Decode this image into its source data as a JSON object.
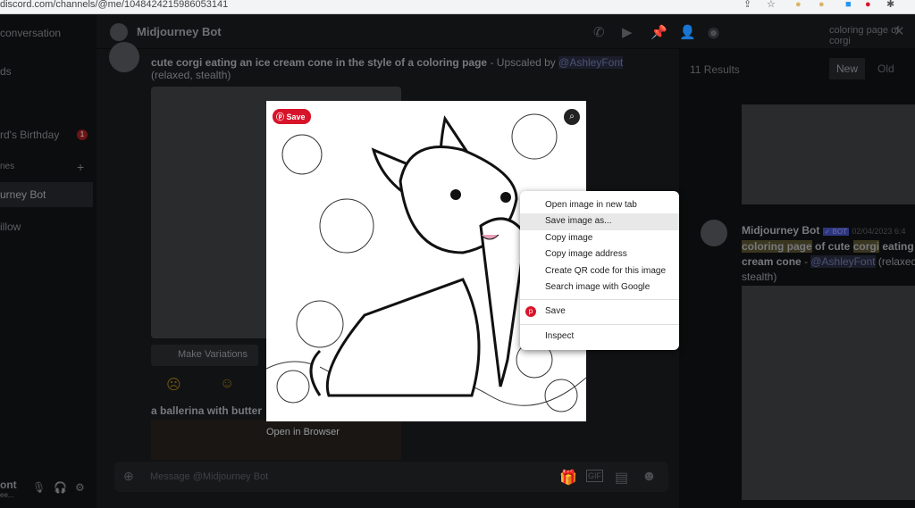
{
  "browser": {
    "url": "discord.com/channels/@me/1048424215986053141"
  },
  "sidebar": {
    "items": [
      {
        "label": "conversation"
      },
      {
        "label": "ds"
      },
      {
        "label": "rd's Birthday",
        "badge": "1"
      },
      {
        "label": "nes",
        "action": "+"
      },
      {
        "label": "urney Bot"
      },
      {
        "label": "illow"
      }
    ],
    "user": {
      "name": "ont",
      "status": "ee..."
    }
  },
  "header": {
    "title": "Midjourney Bot",
    "search": "coloring page of corgi"
  },
  "messages": [
    {
      "text": "cute corgi eating an ice cream cone in the style of a coloring page",
      "suffix": " - Upscaled by ",
      "mention": "@AshleyFont",
      "meta": "(relaxed, stealth)"
    },
    {
      "button": "Make Variations"
    },
    {
      "text": "a ballerina with butter"
    }
  ],
  "results": {
    "count": "11 Results",
    "tabs": [
      "New",
      "Old"
    ],
    "item": {
      "author": "Midjourney Bot",
      "tag": "✓ BOT",
      "date": "02/04/2023 6:4",
      "text1": "coloring page",
      "text2": " of cute ",
      "text3": "corgi",
      "text4": " eating an ice",
      "text5": "cream cone",
      "text6": " - ",
      "mention": "@AshleyFont",
      "meta": " (relaxed,",
      "meta2": "stealth)"
    }
  },
  "compose": {
    "placeholder": "Message @Midjourney Bot"
  },
  "viewer": {
    "pin_save": "Save",
    "open_browser": "Open in Browser"
  },
  "context_menu": {
    "items": [
      "Open image in new tab",
      "Save image as...",
      "Copy image",
      "Copy image address",
      "Create QR code for this image",
      "Search image with Google",
      "Save",
      "Inspect"
    ]
  },
  "colors": {
    "pinterest": "#d8142a",
    "accent": "#5865f2"
  }
}
